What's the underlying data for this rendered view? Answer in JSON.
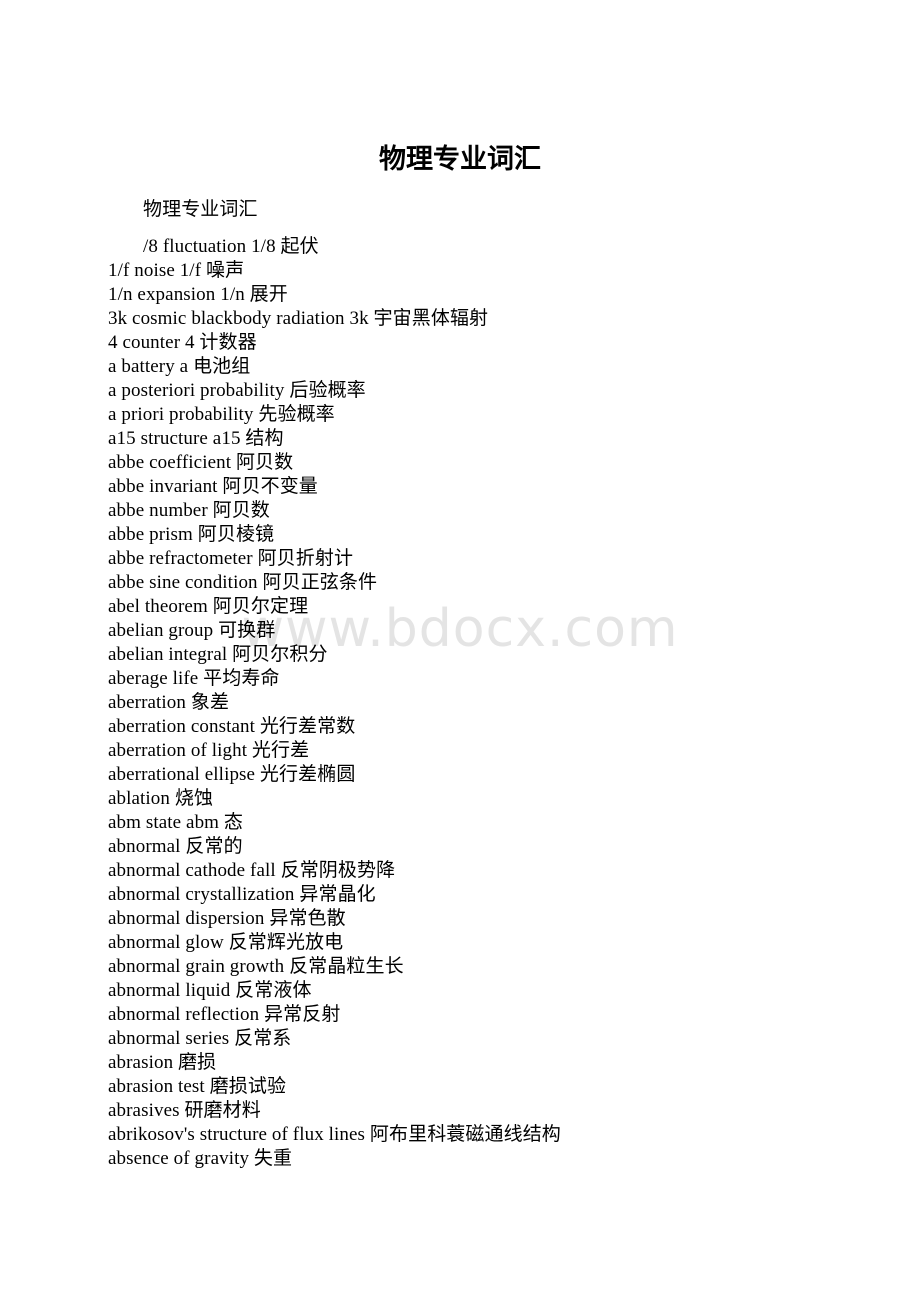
{
  "document": {
    "title": "物理专业词汇",
    "watermark": "www.bdocx.com",
    "heading_line": "物理专业词汇",
    "entries": [
      "/8 fluctuation 1/8 起伏",
      "1/f noise 1/f 噪声",
      "1/n expansion 1/n 展开",
      "3k cosmic blackbody radiation 3k 宇宙黑体辐射",
      "4 counter 4 计数器",
      "a battery a 电池组",
      "a posteriori probability 后验概率",
      "a priori probability 先验概率",
      "a15 structure a15 结构",
      "abbe coefficient 阿贝数",
      "abbe invariant 阿贝不变量",
      "abbe number 阿贝数",
      "abbe prism 阿贝棱镜",
      "abbe refractometer 阿贝折射计",
      "abbe sine condition 阿贝正弦条件",
      "abel theorem 阿贝尔定理",
      "abelian group 可换群",
      "abelian integral 阿贝尔积分",
      "aberage life 平均寿命",
      "aberration 象差",
      "aberration constant 光行差常数",
      "aberration of light 光行差",
      "aberrational ellipse 光行差椭圆",
      "ablation 烧蚀",
      "abm state abm 态",
      "abnormal 反常的",
      "abnormal cathode fall 反常阴极势降",
      "abnormal crystallization 异常晶化",
      "abnormal dispersion 异常色散",
      "abnormal glow 反常辉光放电",
      "abnormal grain growth 反常晶粒生长",
      "abnormal liquid 反常液体",
      "abnormal reflection 异常反射",
      "abnormal series 反常系",
      "abrasion 磨损",
      "abrasion test 磨损试验",
      "abrasives 研磨材料",
      "abrikosov's structure of flux lines 阿布里科蓑磁通线结构",
      "absence of gravity 失重"
    ]
  },
  "colors": {
    "page_background": "#ffffff",
    "text": "#000000",
    "watermark": "#e4e4e4"
  }
}
